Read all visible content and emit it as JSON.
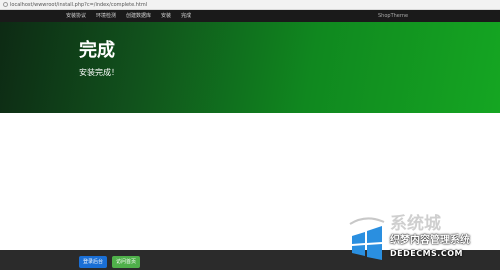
{
  "browser": {
    "url": "localhost/wwwroot/install.php?c=/index/complete.html"
  },
  "navbar": {
    "items": [
      "安装协议",
      "环境检测",
      "创建数据库",
      "安装",
      "完成"
    ],
    "right_text": "ShopTherne"
  },
  "hero": {
    "title": "完成",
    "subtitle": "安装完成！"
  },
  "footer": {
    "primary_button": "登录后台",
    "secondary_button": "访问首页"
  },
  "watermark": {
    "title": "系统城",
    "subtitle": "织梦内容管理系统",
    "domain": "DEDECMS.COM"
  },
  "colors": {
    "nav_bg": "#1a1a1a",
    "hero_dark": "#0d2a14",
    "hero_light": "#15a622",
    "footer_bg": "#2b2b2b",
    "btn_primary": "#1a6fd6",
    "btn_success": "#4fb04a"
  }
}
